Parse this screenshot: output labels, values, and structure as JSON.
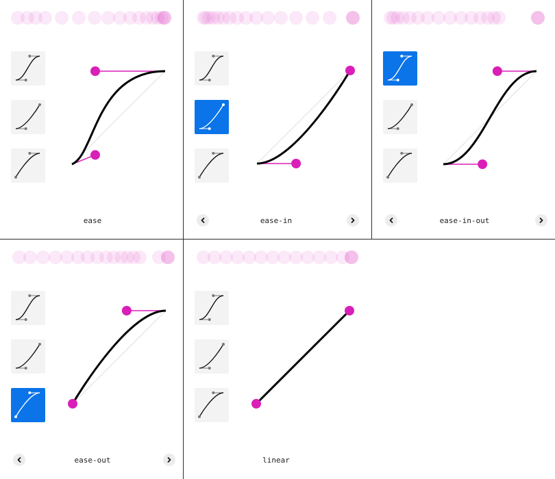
{
  "colors": {
    "accent": "#0a74e8",
    "handle": "#d91fb7",
    "curve": "#000000",
    "thumb_off": "#f3f3f3",
    "divider": "#2b2b2b"
  },
  "presets": [
    {
      "id": "ease-in-out",
      "points": [
        0.42,
        0,
        0.58,
        1
      ]
    },
    {
      "id": "ease-in",
      "points": [
        0.42,
        0,
        1,
        1
      ]
    },
    {
      "id": "ease-out",
      "points": [
        0,
        0,
        0.58,
        1
      ]
    }
  ],
  "panels": [
    {
      "label": "ease",
      "points": [
        0.25,
        0.1,
        0.25,
        1
      ],
      "thumbs": [
        "ease-in-out",
        "ease-in",
        "ease-out"
      ],
      "selected": -1,
      "prev": false,
      "next": false,
      "prev_icon": "chevron-left-icon",
      "next_icon": "chevron-right-icon"
    },
    {
      "label": "ease-in",
      "points": [
        0.42,
        0,
        1,
        1
      ],
      "thumbs": [
        "ease-in-out",
        "ease-in",
        "ease-out"
      ],
      "selected": 1,
      "prev": true,
      "next": true,
      "prev_icon": "chevron-left-icon",
      "next_icon": "chevron-right-icon"
    },
    {
      "label": "ease-in-out",
      "points": [
        0.42,
        0,
        0.58,
        1
      ],
      "thumbs": [
        "ease-in-out",
        "ease-in",
        "ease-out"
      ],
      "selected": 0,
      "prev": true,
      "next": true,
      "prev_icon": "chevron-left-icon",
      "next_icon": "chevron-right-icon"
    },
    {
      "label": "ease-out",
      "points": [
        0,
        0,
        0.58,
        1
      ],
      "thumbs": [
        "ease-in-out",
        "ease-in",
        "ease-out"
      ],
      "selected": 2,
      "prev": true,
      "next": true,
      "prev_icon": "chevron-left-icon",
      "next_icon": "chevron-right-icon"
    },
    {
      "label": "linear",
      "points": [
        0,
        0,
        1,
        1
      ],
      "thumbs": [
        "ease-in-out",
        "ease-in",
        "ease-out"
      ],
      "selected": -1,
      "prev": false,
      "next": false,
      "prev_icon": "chevron-left-icon",
      "next_icon": "chevron-right-icon"
    }
  ]
}
